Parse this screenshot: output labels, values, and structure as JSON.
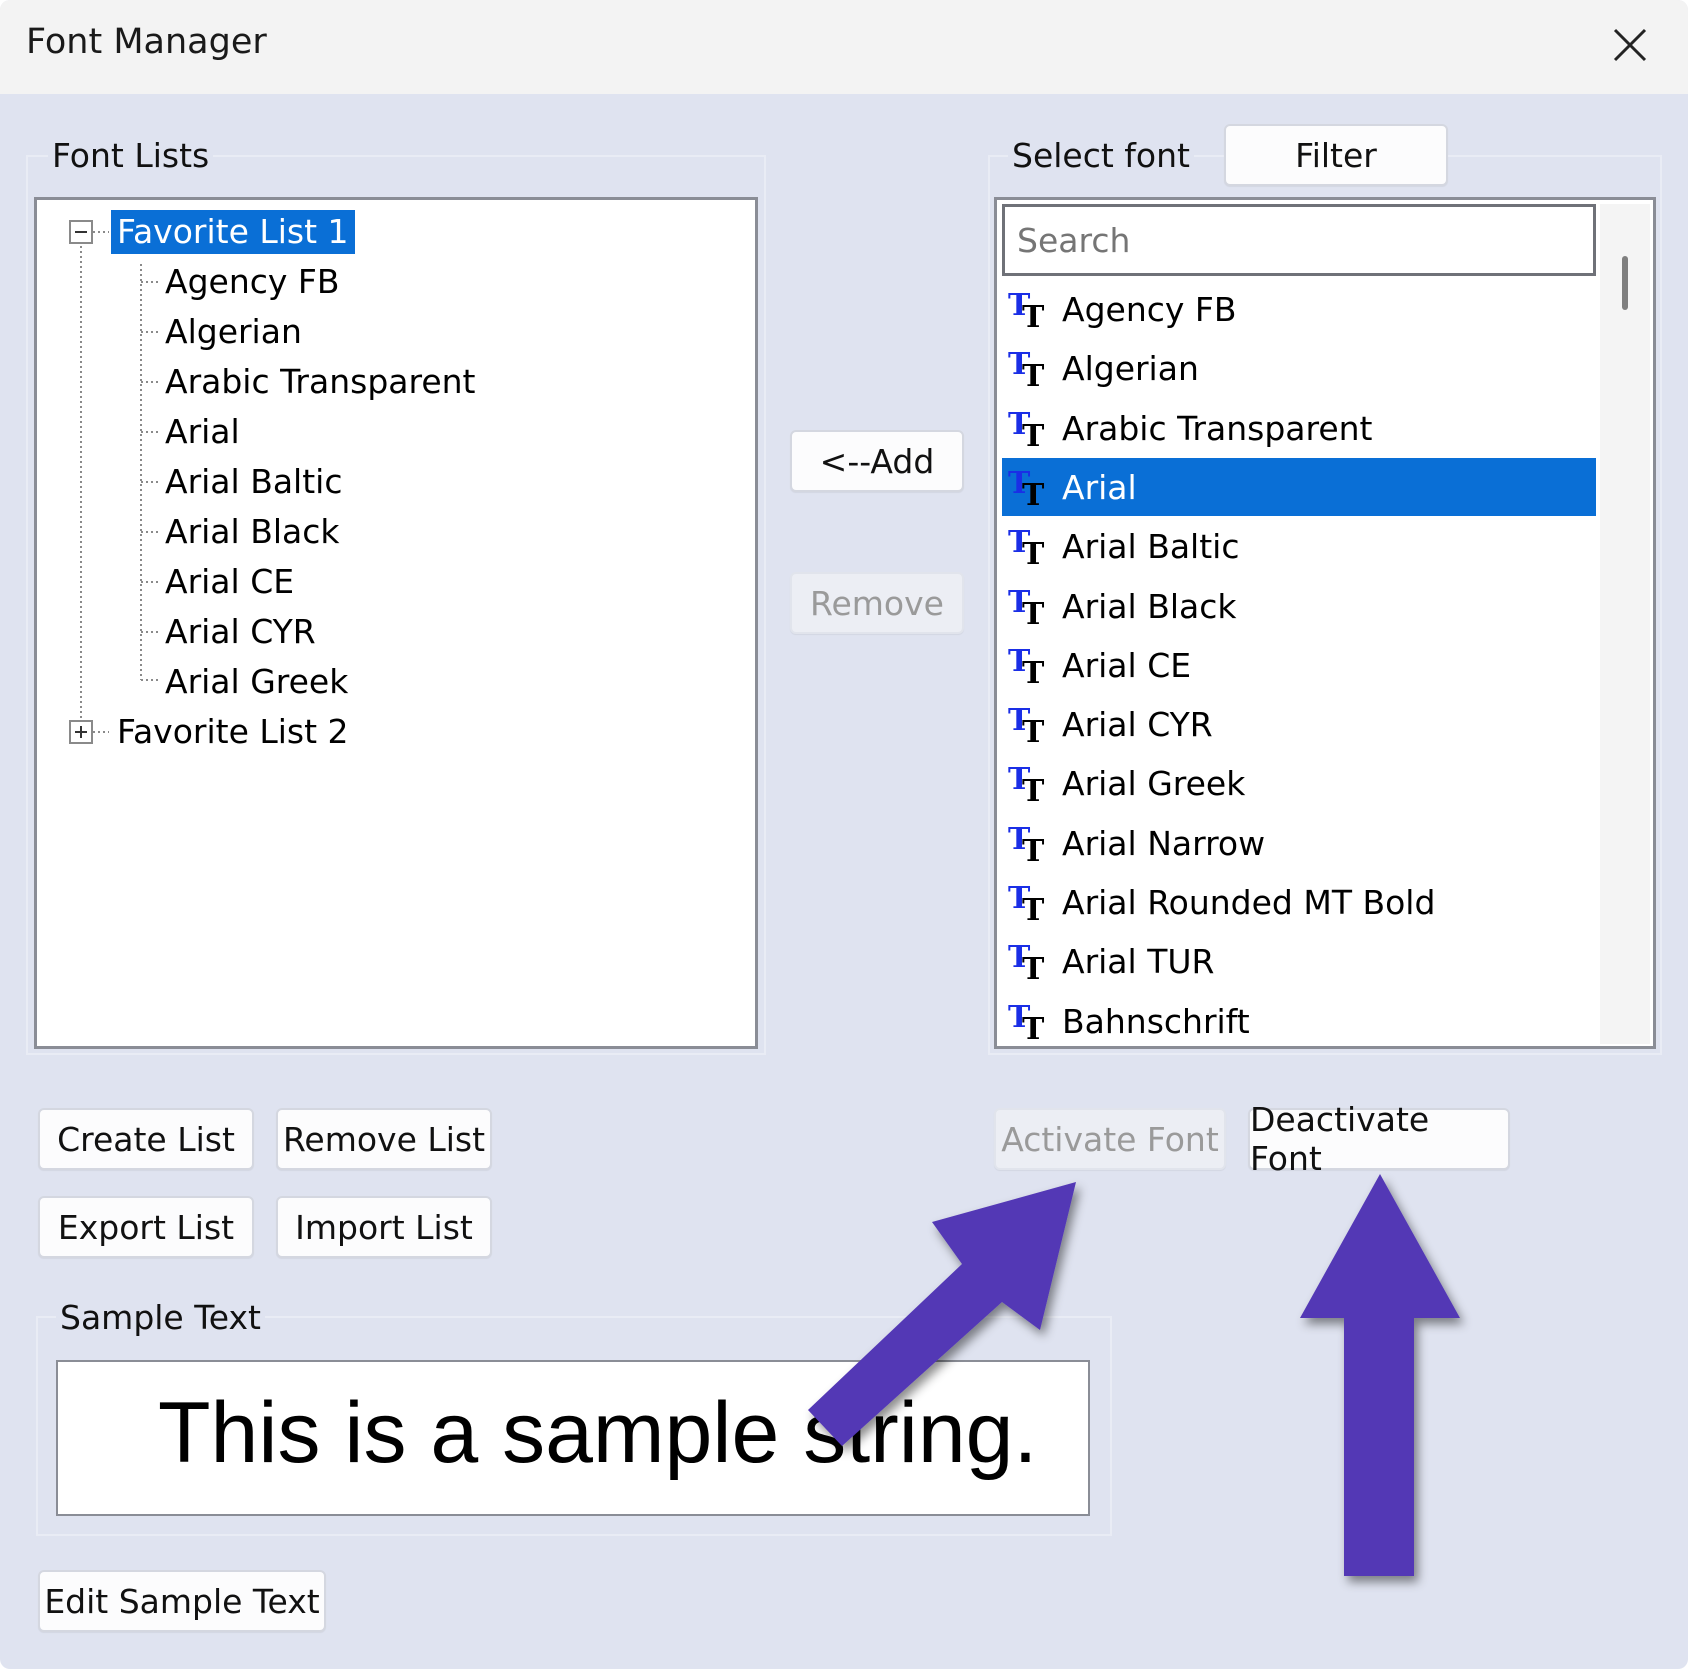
{
  "window": {
    "title": "Font Manager"
  },
  "font_lists": {
    "label": "Font Lists",
    "tree": [
      {
        "label": "Favorite List 1",
        "expanded": true,
        "selected": true,
        "children": [
          "Agency FB",
          "Algerian",
          "Arabic Transparent",
          "Arial",
          "Arial Baltic",
          "Arial Black",
          "Arial CE",
          "Arial CYR",
          "Arial Greek"
        ]
      },
      {
        "label": "Favorite List 2",
        "expanded": false,
        "selected": false,
        "children": []
      }
    ]
  },
  "middle": {
    "add_label": "<--Add",
    "remove_label": "Remove"
  },
  "select_font": {
    "label": "Select font",
    "filter_label": "Filter",
    "search_placeholder": "Search",
    "selected_index": 3,
    "fonts": [
      "Agency FB",
      "Algerian",
      "Arabic Transparent",
      "Arial",
      "Arial Baltic",
      "Arial Black",
      "Arial CE",
      "Arial CYR",
      "Arial Greek",
      "Arial Narrow",
      "Arial Rounded MT Bold",
      "Arial TUR",
      "Bahnschrift"
    ]
  },
  "list_actions": {
    "create_label": "Create List",
    "remove_label": "Remove List",
    "export_label": "Export List",
    "import_label": "Import List"
  },
  "font_actions": {
    "activate_label": "Activate Font",
    "deactivate_label": "Deactivate Font"
  },
  "sample": {
    "label": "Sample Text",
    "text": "This is a sample string.",
    "edit_label": "Edit Sample Text"
  },
  "colors": {
    "selection": "#0a6fd6",
    "annotation_arrow": "#5237b5",
    "window_bg": "#dfe3f0"
  },
  "icons": {
    "font_item": "truetype-icon",
    "close": "close-icon"
  }
}
